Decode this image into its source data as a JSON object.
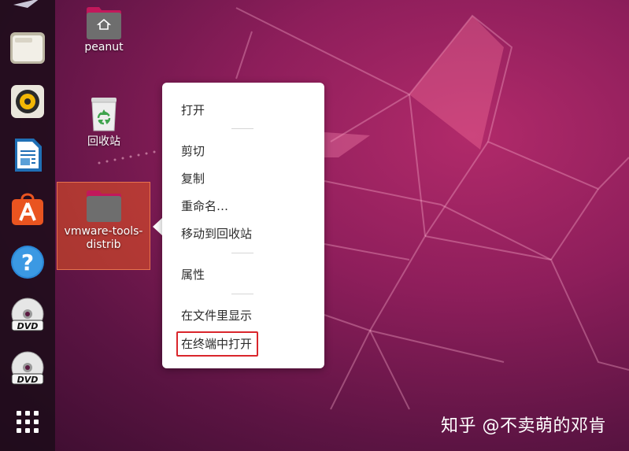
{
  "desktop": {
    "icons": [
      {
        "label": "peanut",
        "type": "home-folder"
      },
      {
        "label": "回收站",
        "type": "trash"
      },
      {
        "label_line1": "vmware-tools-",
        "label_line2": "distrib",
        "type": "folder",
        "selected": true
      }
    ]
  },
  "dock": {
    "items": [
      {
        "name": "files-app",
        "icon": "folder-icon"
      },
      {
        "name": "rhythmbox-app",
        "icon": "speaker-icon"
      },
      {
        "name": "libreoffice-writer-app",
        "icon": "document-icon"
      },
      {
        "name": "ubuntu-software-app",
        "icon": "shopping-bag-icon"
      },
      {
        "name": "help-app",
        "icon": "question-mark-icon"
      },
      {
        "name": "dvd-drive-1",
        "icon": "dvd-icon"
      },
      {
        "name": "dvd-drive-2",
        "icon": "dvd-icon"
      },
      {
        "name": "show-applications",
        "icon": "app-grid-icon"
      }
    ],
    "dvd_label": "DVD"
  },
  "context_menu": {
    "open": "打开",
    "cut": "剪切",
    "copy": "复制",
    "rename": "重命名…",
    "move_to_trash": "移动到回收站",
    "properties": "属性",
    "show_in_files": "在文件里显示",
    "open_in_terminal": "在终端中打开",
    "highlighted_item": "open_in_terminal"
  },
  "watermark": "知乎 @不卖萌的邓肯",
  "colors": {
    "accent": "#E95420",
    "highlight_border": "#D9262C",
    "folder": "#6E6E6E",
    "folder_tab": "#C2185B"
  }
}
